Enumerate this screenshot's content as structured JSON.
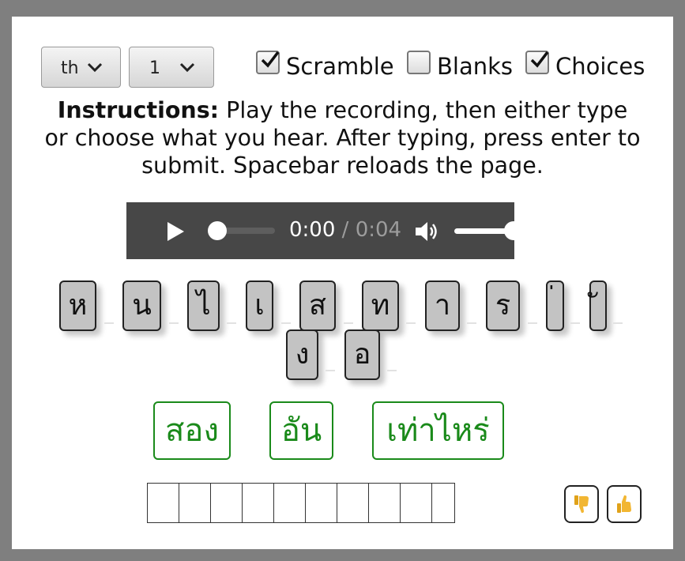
{
  "controls": {
    "language_select": {
      "value": "th"
    },
    "level_select": {
      "value": "1"
    },
    "options": [
      {
        "label": "Scramble",
        "checked": true
      },
      {
        "label": "Blanks",
        "checked": false
      },
      {
        "label": "Choices",
        "checked": true
      }
    ]
  },
  "instructions": {
    "heading": "Instructions:",
    "text": "Play the recording, then either type or choose what you hear. After typing, press enter to submit. Spacebar reloads the page."
  },
  "audio": {
    "current_time": "0:00",
    "separator": "/",
    "duration": "0:04",
    "progress": 0,
    "volume": 1
  },
  "scramble_tiles": [
    "ห",
    "น",
    "ไ",
    "เ",
    "ส",
    "ท",
    "า",
    "ร",
    "่",
    "ั",
    "ง",
    "อ"
  ],
  "choices": [
    "สอง",
    "อัน",
    "เท่าไหร่"
  ],
  "answer_boxes": 10,
  "feedback": {
    "thumbs_down_icon": "thumbs-down",
    "thumbs_up_icon": "thumbs-up"
  }
}
